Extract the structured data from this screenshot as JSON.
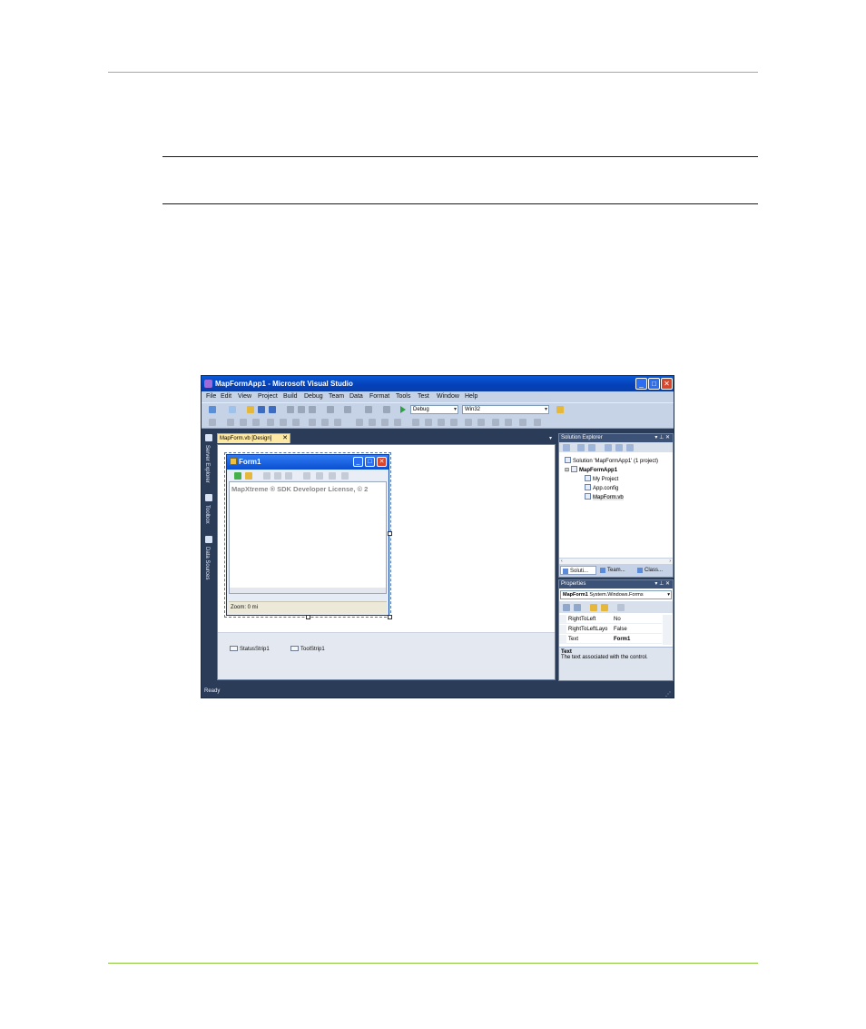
{
  "vs": {
    "title": "MapFormApp1 - Microsoft Visual Studio",
    "menu": [
      "File",
      "Edit",
      "View",
      "Project",
      "Build",
      "Debug",
      "Team",
      "Data",
      "Format",
      "Tools",
      "Test",
      "Window",
      "Help"
    ],
    "toolbar": {
      "config": "Debug",
      "platform": "Win32"
    },
    "side_tabs": [
      "Server Explorer",
      "Toolbox",
      "Data Sources"
    ],
    "doc_tab": "MapForm.vb [Design]",
    "form": {
      "title": "Form1",
      "map_text": "MapXtreme ® SDK Developer License, © 2",
      "status": "Zoom: 0 mi"
    },
    "tray": [
      "StatusStrip1",
      "ToolStrip1"
    ],
    "solution_explorer": {
      "title": "Solution Explorer",
      "tree": [
        "Solution 'MapFormApp1' (1 project)",
        "MapFormApp1",
        "My Project",
        "App.config",
        "MapForm.vb"
      ],
      "tabs": [
        "Soluti...",
        "Team...",
        "Class..."
      ]
    },
    "properties": {
      "title": "Properties",
      "object_name": "MapForm1",
      "object_type": "System.Windows.Forms",
      "rows": [
        {
          "name": "RightToLeft",
          "value": "No"
        },
        {
          "name": "RightToLeftLayo",
          "value": "False"
        },
        {
          "name": "Text",
          "value": "Form1"
        }
      ],
      "desc_title": "Text",
      "desc_text": "The text associated with the control."
    },
    "status": "Ready",
    "colors": {
      "title_bar": "#0a58d6",
      "chrome": "#c6d3e7",
      "frame": "#2b3c59",
      "rule": "#8dc63f"
    }
  }
}
